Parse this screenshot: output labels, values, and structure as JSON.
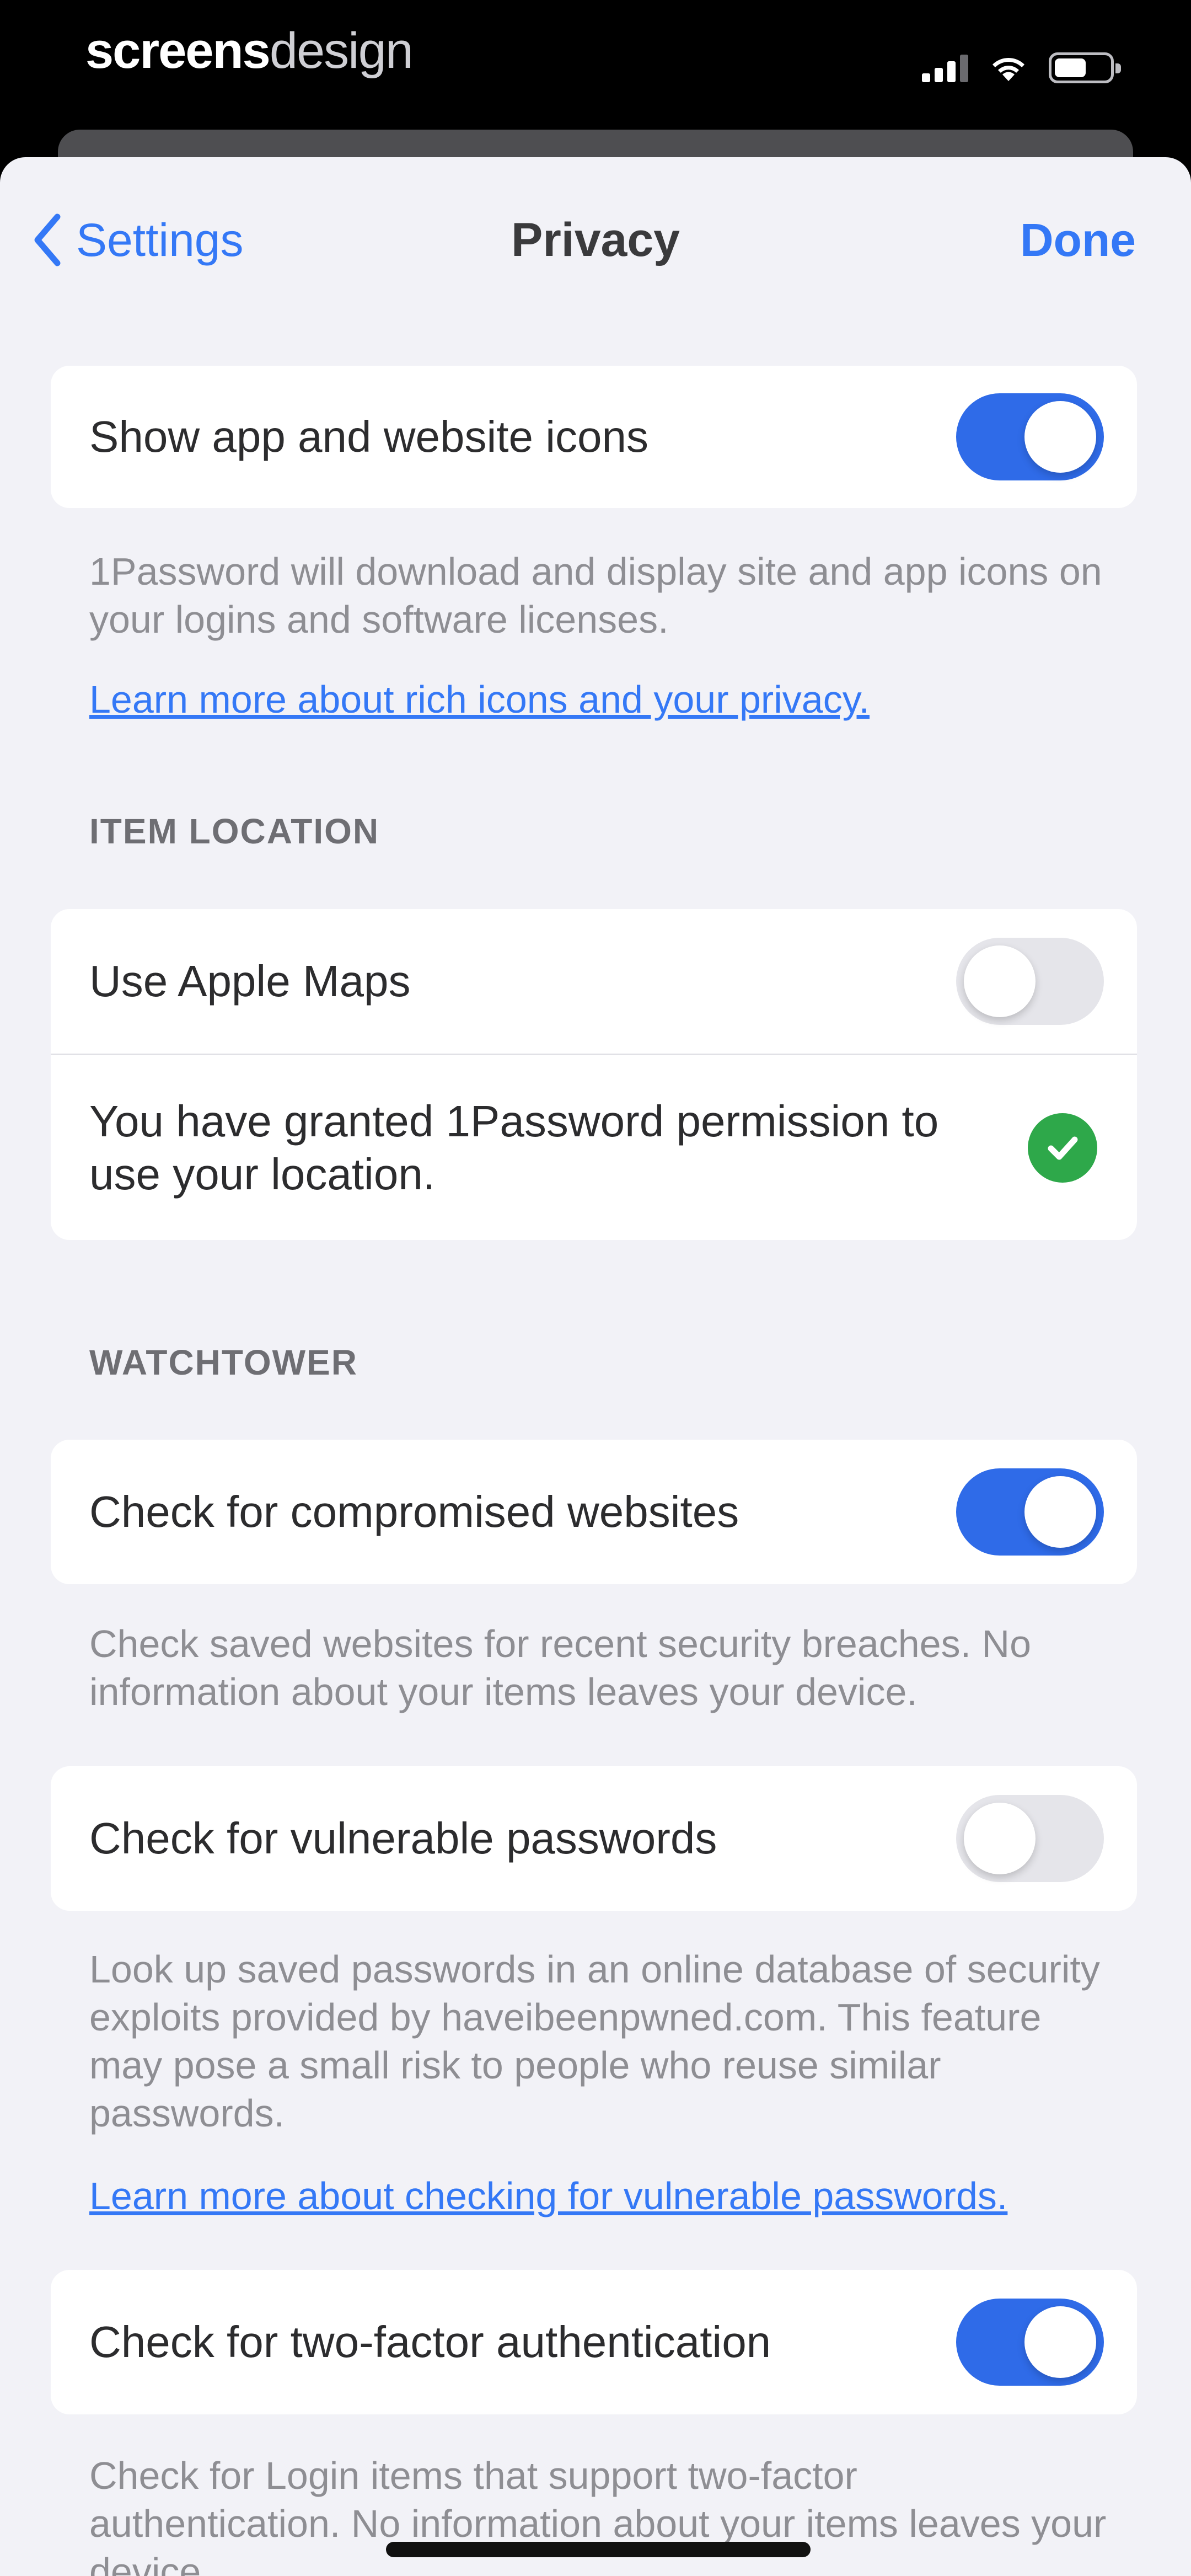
{
  "status_bar": {
    "brand_bold": "screens",
    "brand_light": "design",
    "icons": [
      "cellular-signal-icon",
      "wifi-icon",
      "battery-icon"
    ]
  },
  "nav": {
    "back_label": "Settings",
    "title": "Privacy",
    "done_label": "Done"
  },
  "icons_section": {
    "toggle_label": "Show app and website icons",
    "toggle_on": true,
    "footer": "1Password will download and display site and app icons on your logins and software licenses.",
    "link": "Learn more about rich icons and your privacy."
  },
  "item_location": {
    "header": "ITEM LOCATION",
    "maps_label": "Use Apple Maps",
    "maps_on": false,
    "permission_text": "You have granted 1Password permission to use your location."
  },
  "watchtower": {
    "header": "WATCHTOWER",
    "compromised_label": "Check for compromised websites",
    "compromised_on": true,
    "compromised_footer": "Check saved websites for recent security breaches. No information about your items leaves your device.",
    "vulnerable_label": "Check for vulnerable passwords",
    "vulnerable_on": false,
    "vulnerable_footer": "Look up saved passwords in an online database of security exploits provided by haveibeenpwned.com. This feature may pose a small risk to people who reuse similar passwords.",
    "vulnerable_link": "Learn more about checking for vulnerable passwords.",
    "twofactor_label": "Check for two-factor authentication",
    "twofactor_on": true,
    "twofactor_footer": "Check for Login items that support two-factor authentication. No information about your items leaves your device."
  },
  "colors": {
    "accent": "#3478f6",
    "toggle_on": "#2f6be8",
    "toggle_off": "#e5e5ea",
    "success": "#2ea84a",
    "background": "#f2f2f7"
  }
}
